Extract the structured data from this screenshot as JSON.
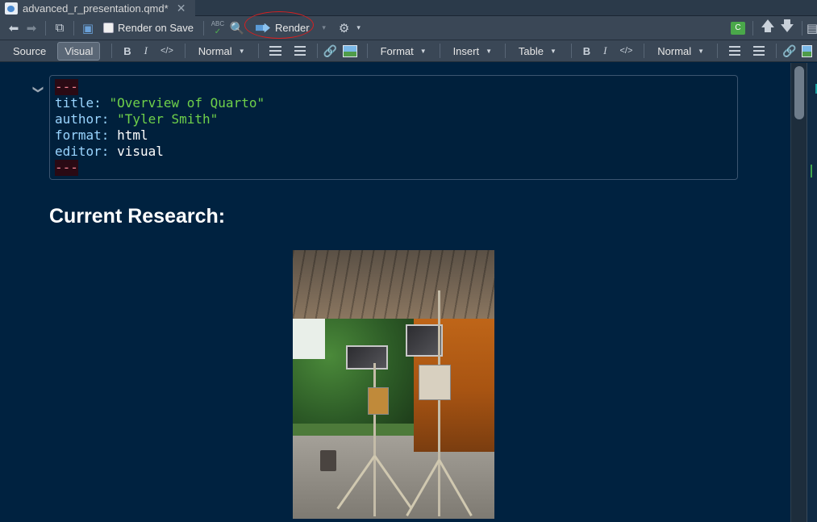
{
  "tab": {
    "filename": "advanced_r_presentation.qmd*",
    "close_glyph": "✕"
  },
  "toolbar": {
    "render_on_save_label": "Render on Save",
    "render_label": "Render",
    "spellcheck_label": "ABC"
  },
  "format_bar": {
    "source_label": "Source",
    "visual_label": "Visual",
    "bold_label": "B",
    "italic_label": "I",
    "code_label": "</>",
    "style_dropdown": "Normal",
    "format_menu": "Format",
    "insert_menu": "Insert",
    "table_menu": "Table",
    "bold_label_2": "B",
    "italic_label_2": "I",
    "code_label_2": "</>",
    "style_dropdown_2": "Normal"
  },
  "yaml": {
    "dashes": "---",
    "title_key": "title",
    "title_value": "\"Overview of Quarto\"",
    "author_key": "author",
    "author_value": "\"Tyler Smith\"",
    "format_key": "format",
    "format_value": "html",
    "editor_key": "editor",
    "editor_value": "visual"
  },
  "document": {
    "heading": "Current Research:"
  }
}
